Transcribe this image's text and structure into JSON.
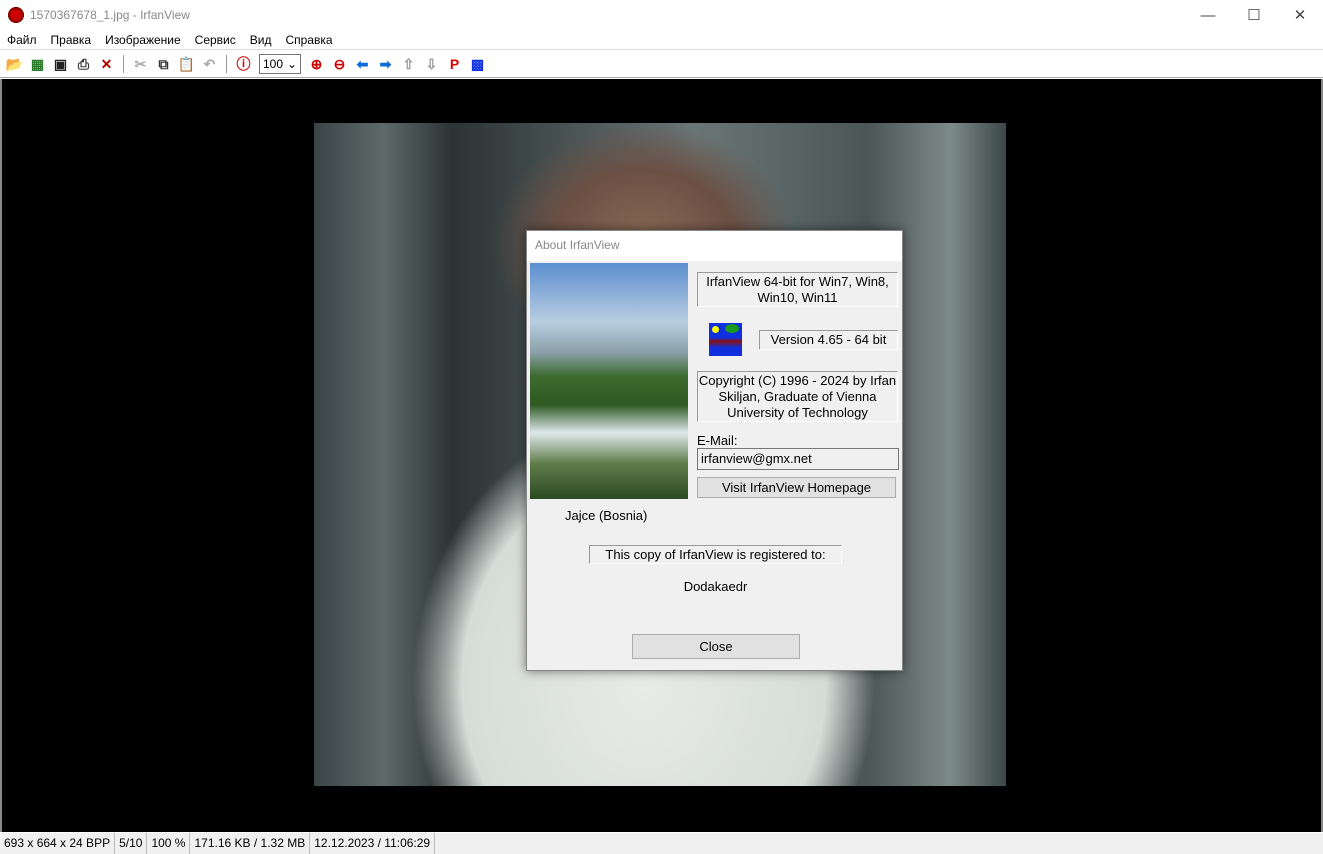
{
  "window": {
    "title": "1570367678_1.jpg - IrfanView",
    "controls": [
      "—",
      "☐",
      "✕"
    ]
  },
  "menu": [
    "Файл",
    "Правка",
    "Изображение",
    "Сервис",
    "Вид",
    "Справка"
  ],
  "toolbar": {
    "group1": [
      {
        "icon": "open-folder-icon",
        "glyph": "📂",
        "color": "#b08000"
      },
      {
        "icon": "slideshow-icon",
        "glyph": "▦",
        "color": "#2a7a2a"
      },
      {
        "icon": "save-icon",
        "glyph": "▣",
        "color": "#222"
      },
      {
        "icon": "print-icon",
        "glyph": "⎙",
        "color": "#333"
      },
      {
        "icon": "delete-icon",
        "glyph": "✕",
        "color": "#b00000"
      }
    ],
    "group2": [
      {
        "icon": "cut-icon",
        "glyph": "✂",
        "color": "#aaa"
      },
      {
        "icon": "copy-icon",
        "glyph": "⧉",
        "color": "#333"
      },
      {
        "icon": "paste-icon",
        "glyph": "📋",
        "color": "#555"
      },
      {
        "icon": "undo-icon",
        "glyph": "↶",
        "color": "#aaa"
      }
    ],
    "info": {
      "icon": "info-icon",
      "glyph": "ⓘ",
      "color": "#d00000"
    },
    "zoom_value": "100",
    "group3": [
      {
        "icon": "zoom-in-icon",
        "glyph": "⊕",
        "color": "#d00000"
      },
      {
        "icon": "zoom-out-icon",
        "glyph": "⊖",
        "color": "#d00000"
      },
      {
        "icon": "previous-icon",
        "glyph": "⬅",
        "color": "#0a6ad8"
      },
      {
        "icon": "next-icon",
        "glyph": "➡",
        "color": "#0a6ad8"
      },
      {
        "icon": "first-icon",
        "glyph": "⇧",
        "color": "#999"
      },
      {
        "icon": "last-icon",
        "glyph": "⇩",
        "color": "#999"
      },
      {
        "icon": "paint-icon",
        "glyph": "P",
        "color": "#e00000"
      },
      {
        "icon": "about-icon",
        "glyph": "▩",
        "color": "#1030e0"
      }
    ]
  },
  "status": [
    "693 x 664 x 24 BPP",
    "5/10",
    "100 %",
    "171.16 KB / 1.32 MB",
    "12.12.2023 / 11:06:29"
  ],
  "about": {
    "title": "About  IrfanView",
    "caption": "Jajce (Bosnia)",
    "product": "IrfanView 64-bit for Win7, Win8, Win10, Win11",
    "version": "Version 4.65 - 64 bit",
    "copyright": "Copyright (C) 1996 - 2024 by Irfan Skiljan, Graduate of Vienna University of Technology",
    "email_label": "E-Mail:",
    "email": "irfanview@gmx.net",
    "homepage_button": "Visit IrfanView Homepage",
    "registered": "This copy of IrfanView is registered to:",
    "owner": "Dodakaedr",
    "close_button": "Close"
  }
}
